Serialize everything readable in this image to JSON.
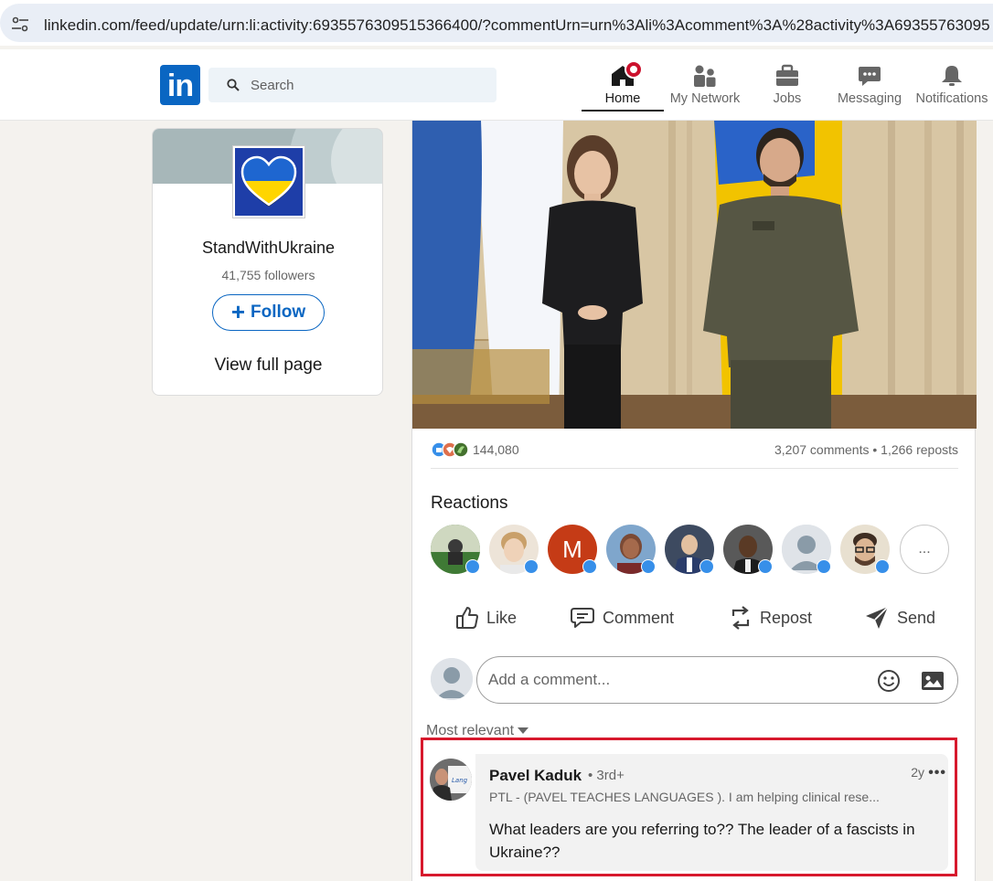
{
  "browser": {
    "url": "linkedin.com/feed/update/urn:li:activity:6935576309515366400/?commentUrn=urn%3Ali%3Acomment%3A%28activity%3A69355763095"
  },
  "nav": {
    "search_placeholder": "Search",
    "items": [
      {
        "label": "Home",
        "icon": "home-icon",
        "active": true
      },
      {
        "label": "My Network",
        "icon": "network-icon"
      },
      {
        "label": "Jobs",
        "icon": "briefcase-icon"
      },
      {
        "label": "Messaging",
        "icon": "messaging-icon"
      },
      {
        "label": "Notifications",
        "icon": "bell-icon"
      }
    ],
    "brand_color": "#0a66c2"
  },
  "sidebar": {
    "org_name": "StandWithUkraine",
    "followers": "41,755 followers",
    "follow_label": "Follow",
    "view_full_page": "View full page"
  },
  "post": {
    "reaction_count": "144,080",
    "comment_stats": "3,207 comments • 1,266 reposts",
    "reactions_title": "Reactions",
    "reactors": [
      {
        "type": "photo",
        "color": "#4a7a3a"
      },
      {
        "type": "photo",
        "color": "#c9a57a"
      },
      {
        "type": "initial",
        "initial": "M",
        "color": "#c53b16"
      },
      {
        "type": "photo",
        "color": "#6f8fb2"
      },
      {
        "type": "photo",
        "color": "#2f3e55"
      },
      {
        "type": "photo",
        "color": "#2b2b2b"
      },
      {
        "type": "placeholder",
        "color": "#dfe3e8"
      },
      {
        "type": "photo",
        "color": "#6b5a48"
      }
    ],
    "more_label": "...",
    "actions": {
      "like": "Like",
      "comment": "Comment",
      "repost": "Repost",
      "send": "Send"
    },
    "composer_placeholder": "Add a comment...",
    "sort_label": "Most relevant"
  },
  "comment": {
    "author": "Pavel Kaduk",
    "degree": "• 3rd+",
    "time": "2y",
    "more": "•••",
    "headline": "PTL - (PAVEL TEACHES LANGUAGES ). I am helping clinical rese...",
    "text": "What leaders are you referring to?? The leader of a fascists in Ukraine??",
    "highlight_color": "#d7192d"
  }
}
